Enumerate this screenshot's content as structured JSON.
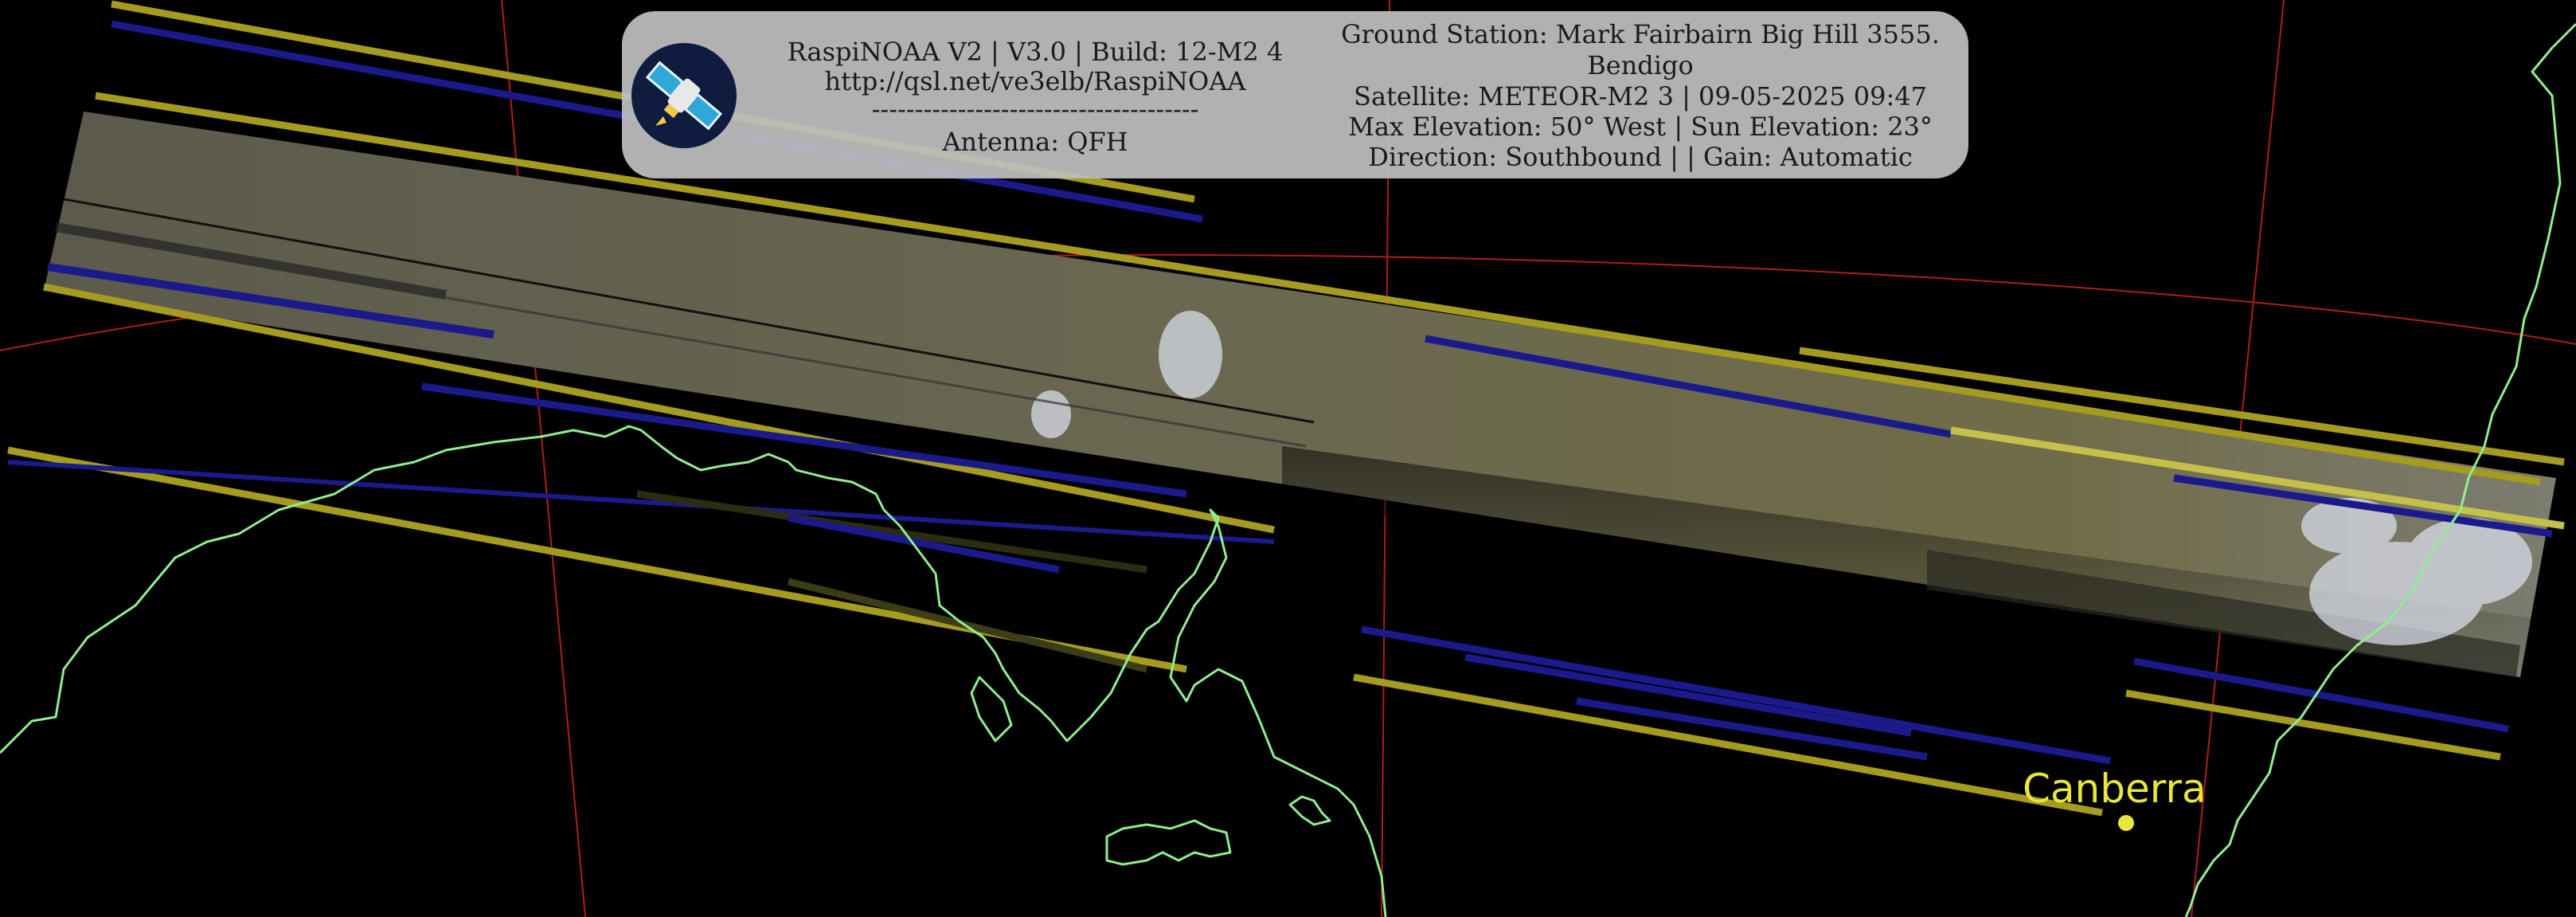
{
  "header": {
    "software": "RaspiNOAA V2 | V3.0 | Build: 12-M2 4",
    "url": "http://qsl.net/ve3elb/RaspiNOAA",
    "divider": "--------------------------------------",
    "antenna": "Antenna: QFH",
    "station_line1": "Ground Station: Mark Fairbairn Big Hill 3555.",
    "station_line2": "Bendigo",
    "satellite": "Satellite: METEOR-M2 3 | 09-05-2025 09:47",
    "elevation": "Max Elevation: 50° West | Sun Elevation: 23°",
    "direction": "Direction: Southbound | | Gain: Automatic"
  },
  "map": {
    "city": "Canberra",
    "coastline_color": "#90ee90",
    "gridline_color": "#c81e1e",
    "city_color": "#e8e53c",
    "logo_icon": "satellite-icon"
  }
}
